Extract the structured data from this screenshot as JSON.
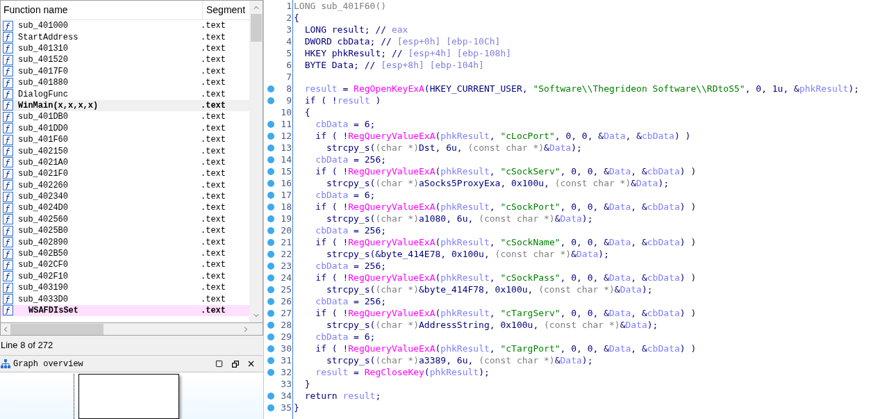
{
  "functions": {
    "columns": [
      "Function name",
      "Segment"
    ],
    "rows": [
      {
        "name": "sub_401000",
        "segment": ".text",
        "selected": false,
        "bold": false,
        "kind": "regular"
      },
      {
        "name": "StartAddress",
        "segment": ".text",
        "selected": false,
        "bold": false,
        "kind": "regular"
      },
      {
        "name": "sub_401310",
        "segment": ".text",
        "selected": false,
        "bold": false,
        "kind": "regular"
      },
      {
        "name": "sub_401520",
        "segment": ".text",
        "selected": false,
        "bold": false,
        "kind": "regular"
      },
      {
        "name": "sub_4017F0",
        "segment": ".text",
        "selected": false,
        "bold": false,
        "kind": "regular"
      },
      {
        "name": "sub_401880",
        "segment": ".text",
        "selected": false,
        "bold": false,
        "kind": "regular"
      },
      {
        "name": "DialogFunc",
        "segment": ".text",
        "selected": false,
        "bold": false,
        "kind": "regular"
      },
      {
        "name": "WinMain(x,x,x,x)",
        "segment": ".text",
        "selected": true,
        "bold": true,
        "kind": "regular"
      },
      {
        "name": "sub_401DB0",
        "segment": ".text",
        "selected": false,
        "bold": false,
        "kind": "regular"
      },
      {
        "name": "sub_401DD0",
        "segment": ".text",
        "selected": false,
        "bold": false,
        "kind": "regular"
      },
      {
        "name": "sub_401F60",
        "segment": ".text",
        "selected": false,
        "bold": false,
        "kind": "regular"
      },
      {
        "name": "sub_402150",
        "segment": ".text",
        "selected": false,
        "bold": false,
        "kind": "regular"
      },
      {
        "name": "sub_4021A0",
        "segment": ".text",
        "selected": false,
        "bold": false,
        "kind": "regular"
      },
      {
        "name": "sub_4021F0",
        "segment": ".text",
        "selected": false,
        "bold": false,
        "kind": "regular"
      },
      {
        "name": "sub_402260",
        "segment": ".text",
        "selected": false,
        "bold": false,
        "kind": "regular"
      },
      {
        "name": "sub_402340",
        "segment": ".text",
        "selected": false,
        "bold": false,
        "kind": "regular"
      },
      {
        "name": "sub_4024D0",
        "segment": ".text",
        "selected": false,
        "bold": false,
        "kind": "regular"
      },
      {
        "name": "sub_402560",
        "segment": ".text",
        "selected": false,
        "bold": false,
        "kind": "regular"
      },
      {
        "name": "sub_4025B0",
        "segment": ".text",
        "selected": false,
        "bold": false,
        "kind": "regular"
      },
      {
        "name": "sub_402890",
        "segment": ".text",
        "selected": false,
        "bold": false,
        "kind": "regular"
      },
      {
        "name": "sub_402B50",
        "segment": ".text",
        "selected": false,
        "bold": false,
        "kind": "regular"
      },
      {
        "name": "sub_402CF0",
        "segment": ".text",
        "selected": false,
        "bold": false,
        "kind": "regular"
      },
      {
        "name": "sub_402F10",
        "segment": ".text",
        "selected": false,
        "bold": false,
        "kind": "regular"
      },
      {
        "name": "sub_403190",
        "segment": ".text",
        "selected": false,
        "bold": false,
        "kind": "regular"
      },
      {
        "name": "sub_4033D0",
        "segment": ".text",
        "selected": false,
        "bold": false,
        "kind": "regular"
      },
      {
        "name": "WSAFDIsSet",
        "segment": ".text",
        "selected": false,
        "bold": true,
        "kind": "library"
      }
    ]
  },
  "status": "Line 8 of 272",
  "graph_overview": {
    "title": "Graph overview"
  },
  "code": [
    {
      "number": "1",
      "breakpoint": false,
      "tokens": [
        {
          "text": "LONG sub_401F60()",
          "kind": "gray"
        }
      ]
    },
    {
      "number": "2",
      "breakpoint": false,
      "tokens": [
        {
          "text": "{",
          "kind": "plain"
        }
      ]
    },
    {
      "number": "3",
      "breakpoint": false,
      "tokens": [
        {
          "text": "  LONG result; // ",
          "kind": "plain"
        },
        {
          "text": "eax",
          "kind": "comment"
        }
      ]
    },
    {
      "number": "4",
      "breakpoint": false,
      "tokens": [
        {
          "text": "  DWORD cbData; // ",
          "kind": "plain"
        },
        {
          "text": "[esp+0h] [ebp-10Ch]",
          "kind": "comment"
        }
      ]
    },
    {
      "number": "5",
      "breakpoint": false,
      "tokens": [
        {
          "text": "  HKEY phkResult; // ",
          "kind": "plain"
        },
        {
          "text": "[esp+4h] [ebp-108h]",
          "kind": "comment"
        }
      ]
    },
    {
      "number": "6",
      "breakpoint": false,
      "tokens": [
        {
          "text": "  BYTE Data; // ",
          "kind": "plain"
        },
        {
          "text": "[esp+8h] [ebp-104h]",
          "kind": "comment"
        }
      ]
    },
    {
      "number": "7",
      "breakpoint": false
    },
    {
      "number": "8",
      "breakpoint": true,
      "tokens": [
        {
          "text": "  result",
          "kind": "var"
        },
        {
          "text": " = ",
          "kind": "plain"
        },
        {
          "text": "RegOpenKeyExA",
          "kind": "import"
        },
        {
          "text": "(HKEY_CURRENT_USER, ",
          "kind": "plain"
        },
        {
          "text": "\"Software\\\\Thegrideon Software\\\\RDtoS5\"",
          "kind": "string"
        },
        {
          "text": ", 0, 1u, &",
          "kind": "plain"
        },
        {
          "text": "phkResult",
          "kind": "var"
        },
        {
          "text": ");",
          "kind": "plain"
        }
      ]
    },
    {
      "number": "9",
      "breakpoint": true,
      "tokens": [
        {
          "text": "  if ( !",
          "kind": "plain"
        },
        {
          "text": "result",
          "kind": "var"
        },
        {
          "text": " )",
          "kind": "plain"
        }
      ]
    },
    {
      "number": "10",
      "breakpoint": false,
      "tokens": [
        {
          "text": "  {",
          "kind": "plain"
        }
      ]
    },
    {
      "number": "11",
      "breakpoint": true,
      "tokens": [
        {
          "text": "    cbData",
          "kind": "var"
        },
        {
          "text": " = 6;",
          "kind": "plain"
        }
      ]
    },
    {
      "number": "12",
      "breakpoint": true,
      "tokens": [
        {
          "text": "    if ( !",
          "kind": "plain"
        },
        {
          "text": "RegQueryValueExA",
          "kind": "import"
        },
        {
          "text": "(",
          "kind": "plain"
        },
        {
          "text": "phkResult",
          "kind": "var"
        },
        {
          "text": ", ",
          "kind": "plain"
        },
        {
          "text": "\"cLocPort\"",
          "kind": "string"
        },
        {
          "text": ", 0, 0, &",
          "kind": "plain"
        },
        {
          "text": "Data",
          "kind": "var"
        },
        {
          "text": ", &",
          "kind": "plain"
        },
        {
          "text": "cbData",
          "kind": "var"
        },
        {
          "text": ") )",
          "kind": "plain"
        }
      ]
    },
    {
      "number": "13",
      "breakpoint": true,
      "tokens": [
        {
          "text": "      strcpy_s(",
          "kind": "plain"
        },
        {
          "text": "(char *)",
          "kind": "gray"
        },
        {
          "text": "Dst, 6u, ",
          "kind": "plain"
        },
        {
          "text": "(const char *)",
          "kind": "gray"
        },
        {
          "text": "&",
          "kind": "plain"
        },
        {
          "text": "Data",
          "kind": "var"
        },
        {
          "text": ");",
          "kind": "plain"
        }
      ]
    },
    {
      "number": "14",
      "breakpoint": true,
      "tokens": [
        {
          "text": "    cbData",
          "kind": "var"
        },
        {
          "text": " = 256;",
          "kind": "plain"
        }
      ]
    },
    {
      "number": "15",
      "breakpoint": true,
      "tokens": [
        {
          "text": "    if ( !",
          "kind": "plain"
        },
        {
          "text": "RegQueryValueExA",
          "kind": "import"
        },
        {
          "text": "(",
          "kind": "plain"
        },
        {
          "text": "phkResult",
          "kind": "var"
        },
        {
          "text": ", ",
          "kind": "plain"
        },
        {
          "text": "\"cSockServ\"",
          "kind": "string"
        },
        {
          "text": ", 0, 0, &",
          "kind": "plain"
        },
        {
          "text": "Data",
          "kind": "var"
        },
        {
          "text": ", &",
          "kind": "plain"
        },
        {
          "text": "cbData",
          "kind": "var"
        },
        {
          "text": ") )",
          "kind": "plain"
        }
      ]
    },
    {
      "number": "16",
      "breakpoint": true,
      "tokens": [
        {
          "text": "      strcpy_s(",
          "kind": "plain"
        },
        {
          "text": "(char *)",
          "kind": "gray"
        },
        {
          "text": "aSocks5ProxyExa, 0x100u, ",
          "kind": "plain"
        },
        {
          "text": "(const char *)",
          "kind": "gray"
        },
        {
          "text": "&",
          "kind": "plain"
        },
        {
          "text": "Data",
          "kind": "var"
        },
        {
          "text": ");",
          "kind": "plain"
        }
      ]
    },
    {
      "number": "17",
      "breakpoint": true,
      "tokens": [
        {
          "text": "    cbData",
          "kind": "var"
        },
        {
          "text": " = 6;",
          "kind": "plain"
        }
      ]
    },
    {
      "number": "18",
      "breakpoint": true,
      "tokens": [
        {
          "text": "    if ( !",
          "kind": "plain"
        },
        {
          "text": "RegQueryValueExA",
          "kind": "import"
        },
        {
          "text": "(",
          "kind": "plain"
        },
        {
          "text": "phkResult",
          "kind": "var"
        },
        {
          "text": ", ",
          "kind": "plain"
        },
        {
          "text": "\"cSockPort\"",
          "kind": "string"
        },
        {
          "text": ", 0, 0, &",
          "kind": "plain"
        },
        {
          "text": "Data",
          "kind": "var"
        },
        {
          "text": ", &",
          "kind": "plain"
        },
        {
          "text": "cbData",
          "kind": "var"
        },
        {
          "text": ") )",
          "kind": "plain"
        }
      ]
    },
    {
      "number": "19",
      "breakpoint": true,
      "tokens": [
        {
          "text": "      strcpy_s(",
          "kind": "plain"
        },
        {
          "text": "(char *)",
          "kind": "gray"
        },
        {
          "text": "a1080, 6u, ",
          "kind": "plain"
        },
        {
          "text": "(const char *)",
          "kind": "gray"
        },
        {
          "text": "&",
          "kind": "plain"
        },
        {
          "text": "Data",
          "kind": "var"
        },
        {
          "text": ");",
          "kind": "plain"
        }
      ]
    },
    {
      "number": "20",
      "breakpoint": true,
      "tokens": [
        {
          "text": "    cbData",
          "kind": "var"
        },
        {
          "text": " = 256;",
          "kind": "plain"
        }
      ]
    },
    {
      "number": "21",
      "breakpoint": true,
      "tokens": [
        {
          "text": "    if ( !",
          "kind": "plain"
        },
        {
          "text": "RegQueryValueExA",
          "kind": "import"
        },
        {
          "text": "(",
          "kind": "plain"
        },
        {
          "text": "phkResult",
          "kind": "var"
        },
        {
          "text": ", ",
          "kind": "plain"
        },
        {
          "text": "\"cSockName\"",
          "kind": "string"
        },
        {
          "text": ", 0, 0, &",
          "kind": "plain"
        },
        {
          "text": "Data",
          "kind": "var"
        },
        {
          "text": ", &",
          "kind": "plain"
        },
        {
          "text": "cbData",
          "kind": "var"
        },
        {
          "text": ") )",
          "kind": "plain"
        }
      ]
    },
    {
      "number": "22",
      "breakpoint": true,
      "tokens": [
        {
          "text": "      strcpy_s(&byte_414E78, 0x100u, ",
          "kind": "plain"
        },
        {
          "text": "(const char *)",
          "kind": "gray"
        },
        {
          "text": "&",
          "kind": "plain"
        },
        {
          "text": "Data",
          "kind": "var"
        },
        {
          "text": ");",
          "kind": "plain"
        }
      ]
    },
    {
      "number": "23",
      "breakpoint": true,
      "tokens": [
        {
          "text": "    cbData",
          "kind": "var"
        },
        {
          "text": " = 256;",
          "kind": "plain"
        }
      ]
    },
    {
      "number": "24",
      "breakpoint": true,
      "tokens": [
        {
          "text": "    if ( !",
          "kind": "plain"
        },
        {
          "text": "RegQueryValueExA",
          "kind": "import"
        },
        {
          "text": "(",
          "kind": "plain"
        },
        {
          "text": "phkResult",
          "kind": "var"
        },
        {
          "text": ", ",
          "kind": "plain"
        },
        {
          "text": "\"cSockPass\"",
          "kind": "string"
        },
        {
          "text": ", 0, 0, &",
          "kind": "plain"
        },
        {
          "text": "Data",
          "kind": "var"
        },
        {
          "text": ", &",
          "kind": "plain"
        },
        {
          "text": "cbData",
          "kind": "var"
        },
        {
          "text": ") )",
          "kind": "plain"
        }
      ]
    },
    {
      "number": "25",
      "breakpoint": true,
      "tokens": [
        {
          "text": "      strcpy_s(",
          "kind": "plain"
        },
        {
          "text": "(char *)",
          "kind": "gray"
        },
        {
          "text": "&byte_414F78, 0x100u, ",
          "kind": "plain"
        },
        {
          "text": "(const char *)",
          "kind": "gray"
        },
        {
          "text": "&",
          "kind": "plain"
        },
        {
          "text": "Data",
          "kind": "var"
        },
        {
          "text": ");",
          "kind": "plain"
        }
      ]
    },
    {
      "number": "26",
      "breakpoint": true,
      "tokens": [
        {
          "text": "    cbData",
          "kind": "var"
        },
        {
          "text": " = 256;",
          "kind": "plain"
        }
      ]
    },
    {
      "number": "27",
      "breakpoint": true,
      "tokens": [
        {
          "text": "    if ( !",
          "kind": "plain"
        },
        {
          "text": "RegQueryValueExA",
          "kind": "import"
        },
        {
          "text": "(",
          "kind": "plain"
        },
        {
          "text": "phkResult",
          "kind": "var"
        },
        {
          "text": ", ",
          "kind": "plain"
        },
        {
          "text": "\"cTargServ\"",
          "kind": "string"
        },
        {
          "text": ", 0, 0, &",
          "kind": "plain"
        },
        {
          "text": "Data",
          "kind": "var"
        },
        {
          "text": ", &",
          "kind": "plain"
        },
        {
          "text": "cbData",
          "kind": "var"
        },
        {
          "text": ") )",
          "kind": "plain"
        }
      ]
    },
    {
      "number": "28",
      "breakpoint": true,
      "tokens": [
        {
          "text": "      strcpy_s(",
          "kind": "plain"
        },
        {
          "text": "(char *)",
          "kind": "gray"
        },
        {
          "text": "AddressString, 0x100u, ",
          "kind": "plain"
        },
        {
          "text": "(const char *)",
          "kind": "gray"
        },
        {
          "text": "&",
          "kind": "plain"
        },
        {
          "text": "Data",
          "kind": "var"
        },
        {
          "text": ");",
          "kind": "plain"
        }
      ]
    },
    {
      "number": "29",
      "breakpoint": true,
      "tokens": [
        {
          "text": "    cbData",
          "kind": "var"
        },
        {
          "text": " = 6;",
          "kind": "plain"
        }
      ]
    },
    {
      "number": "30",
      "breakpoint": true,
      "tokens": [
        {
          "text": "    if ( !",
          "kind": "plain"
        },
        {
          "text": "RegQueryValueExA",
          "kind": "import"
        },
        {
          "text": "(",
          "kind": "plain"
        },
        {
          "text": "phkResult",
          "kind": "var"
        },
        {
          "text": ", ",
          "kind": "plain"
        },
        {
          "text": "\"cTargPort\"",
          "kind": "string"
        },
        {
          "text": ", 0, 0, &",
          "kind": "plain"
        },
        {
          "text": "Data",
          "kind": "var"
        },
        {
          "text": ", &",
          "kind": "plain"
        },
        {
          "text": "cbData",
          "kind": "var"
        },
        {
          "text": ") )",
          "kind": "plain"
        }
      ]
    },
    {
      "number": "31",
      "breakpoint": true,
      "tokens": [
        {
          "text": "      strcpy_s(",
          "kind": "plain"
        },
        {
          "text": "(char *)",
          "kind": "gray"
        },
        {
          "text": "a3389, 6u, ",
          "kind": "plain"
        },
        {
          "text": "(const char *)",
          "kind": "gray"
        },
        {
          "text": "&",
          "kind": "plain"
        },
        {
          "text": "Data",
          "kind": "var"
        },
        {
          "text": ");",
          "kind": "plain"
        }
      ]
    },
    {
      "number": "32",
      "breakpoint": true,
      "tokens": [
        {
          "text": "    result",
          "kind": "var"
        },
        {
          "text": " = ",
          "kind": "plain"
        },
        {
          "text": "RegCloseKey",
          "kind": "import"
        },
        {
          "text": "(",
          "kind": "plain"
        },
        {
          "text": "phkResult",
          "kind": "var"
        },
        {
          "text": ");",
          "kind": "plain"
        }
      ]
    },
    {
      "number": "33",
      "breakpoint": false,
      "tokens": [
        {
          "text": "  }",
          "kind": "plain"
        }
      ]
    },
    {
      "number": "34",
      "breakpoint": true,
      "tokens": [
        {
          "text": "  return ",
          "kind": "plain"
        },
        {
          "text": "result",
          "kind": "var"
        },
        {
          "text": ";",
          "kind": "plain"
        }
      ]
    },
    {
      "number": "35",
      "breakpoint": true,
      "tokens": [
        {
          "text": "}",
          "kind": "plain"
        }
      ]
    }
  ]
}
